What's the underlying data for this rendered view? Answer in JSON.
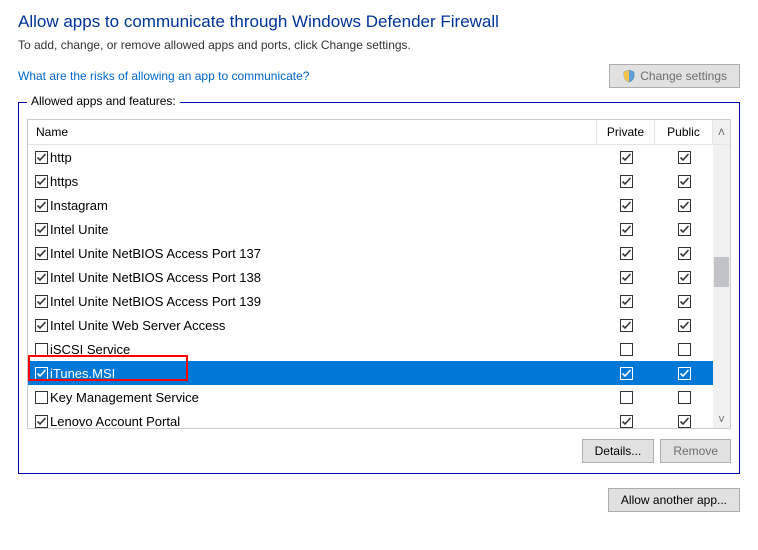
{
  "title": "Allow apps to communicate through Windows Defender Firewall",
  "subtitle": "To add, change, or remove allowed apps and ports, click Change settings.",
  "riskLink": "What are the risks of allowing an app to communicate?",
  "changeSettingsLabel": "Change settings",
  "groupLabel": "Allowed apps and features:",
  "columns": {
    "name": "Name",
    "private": "Private",
    "public": "Public"
  },
  "rows": [
    {
      "name": "http",
      "nameChecked": true,
      "private": true,
      "public": true,
      "selected": false,
      "highlight": false
    },
    {
      "name": "https",
      "nameChecked": true,
      "private": true,
      "public": true,
      "selected": false,
      "highlight": false
    },
    {
      "name": "Instagram",
      "nameChecked": true,
      "private": true,
      "public": true,
      "selected": false,
      "highlight": false
    },
    {
      "name": "Intel Unite",
      "nameChecked": true,
      "private": true,
      "public": true,
      "selected": false,
      "highlight": false
    },
    {
      "name": "Intel Unite NetBIOS Access Port 137",
      "nameChecked": true,
      "private": true,
      "public": true,
      "selected": false,
      "highlight": false
    },
    {
      "name": "Intel Unite NetBIOS Access Port 138",
      "nameChecked": true,
      "private": true,
      "public": true,
      "selected": false,
      "highlight": false
    },
    {
      "name": "Intel Unite NetBIOS Access Port 139",
      "nameChecked": true,
      "private": true,
      "public": true,
      "selected": false,
      "highlight": false
    },
    {
      "name": "Intel Unite Web Server Access",
      "nameChecked": true,
      "private": true,
      "public": true,
      "selected": false,
      "highlight": false
    },
    {
      "name": "iSCSI Service",
      "nameChecked": false,
      "private": false,
      "public": false,
      "selected": false,
      "highlight": false
    },
    {
      "name": "iTunes.MSI",
      "nameChecked": true,
      "private": true,
      "public": true,
      "selected": true,
      "highlight": true
    },
    {
      "name": "Key Management Service",
      "nameChecked": false,
      "private": false,
      "public": false,
      "selected": false,
      "highlight": false
    },
    {
      "name": "Lenovo Account Portal",
      "nameChecked": true,
      "private": true,
      "public": true,
      "selected": false,
      "highlight": false
    }
  ],
  "buttons": {
    "details": "Details...",
    "remove": "Remove",
    "allowAnother": "Allow another app..."
  }
}
